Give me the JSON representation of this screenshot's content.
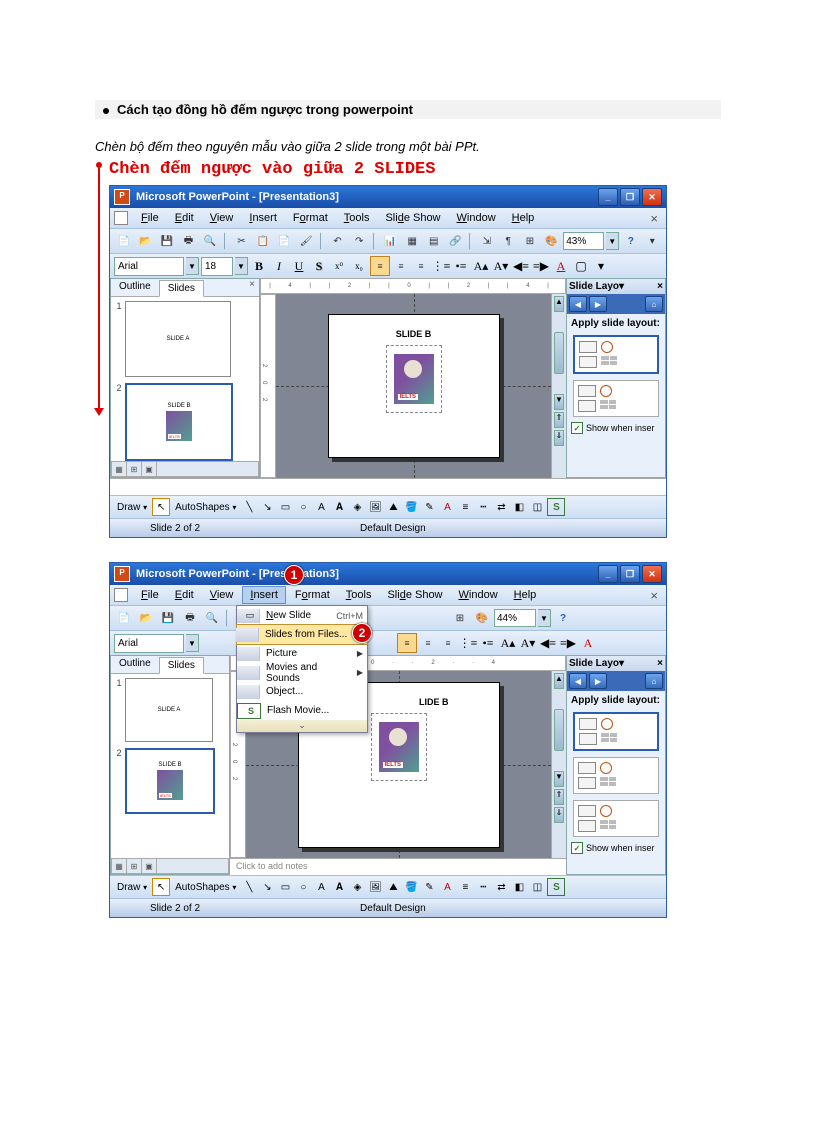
{
  "doc": {
    "heading": "Cách tạo đồng hồ đếm ngược trong powerpoint",
    "desc": "Chèn bộ đếm theo nguyên mẫu vào giữa 2 slide trong một bài PPt.",
    "red_title": "Chèn đếm ngược vào giữa 2 SLIDES"
  },
  "pp": {
    "title": "Microsoft PowerPoint - [Presentation3]",
    "menu": {
      "file": "File",
      "edit": "Edit",
      "view": "View",
      "insert": "Insert",
      "format": "Format",
      "tools": "Tools",
      "slideshow": "Slide Show",
      "window": "Window",
      "help": "Help"
    },
    "zoom1": "43%",
    "zoom2": "44%",
    "font": "Arial",
    "fontsize": "18",
    "tabs": {
      "outline": "Outline",
      "slides": "Slides"
    },
    "thumb1": "SLIDE A",
    "thumb2": "SLIDE B",
    "ruler_h": "| 4 | | 2 | | 0 | | 2 | | 4 |",
    "slide_title": "SLIDE B",
    "taskpane": {
      "title": "Slide Layo",
      "label": "Apply slide layout:",
      "checkbox": "Show when inser"
    },
    "notes": "Click to add notes",
    "draw": {
      "draw": "Draw",
      "autoshapes": "AutoShapes"
    },
    "status": {
      "left": "Slide 2 of 2",
      "right": "Default Design"
    }
  },
  "insert_menu": {
    "new_slide": "New Slide",
    "new_slide_key": "Ctrl+M",
    "slides_from": "Slides from Files...",
    "picture": "Picture",
    "movies": "Movies and Sounds",
    "object": "Object...",
    "flash": "Flash Movie..."
  },
  "badges": {
    "one": "1",
    "two": "2"
  }
}
